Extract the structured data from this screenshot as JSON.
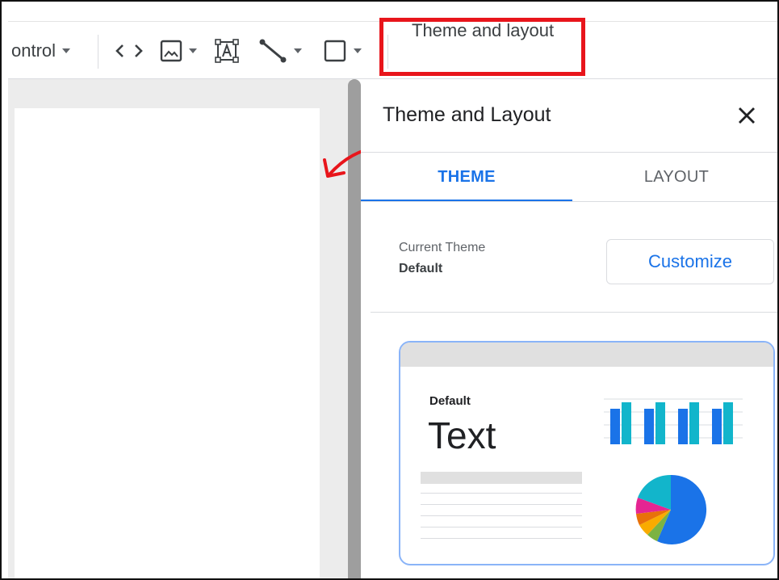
{
  "toolbar": {
    "control_label": "ontrol",
    "theme_button_label": "Theme and layout"
  },
  "panel": {
    "title": "Theme and Layout",
    "tabs": [
      {
        "label": "THEME",
        "active": true
      },
      {
        "label": "LAYOUT",
        "active": false
      }
    ],
    "current_theme_label": "Current Theme",
    "current_theme_value": "Default",
    "customize_label": "Customize",
    "theme_card": {
      "name": "Default",
      "sample_text": "Text"
    }
  },
  "colors": {
    "accent": "#1a73e8",
    "highlight": "#e8151b",
    "card_border": "#8ab4f8",
    "chart_blue": "#1a73e8",
    "chart_teal": "#12b5cb",
    "pie_colors": [
      "#1a73e8",
      "#12b5cb",
      "#e52592",
      "#e8710a",
      "#f9ab00",
      "#7cb342"
    ]
  }
}
